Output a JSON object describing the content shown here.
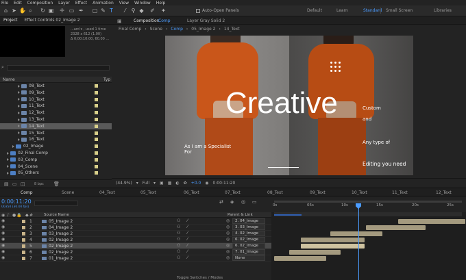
{
  "menu": [
    "File",
    "Edit",
    "Composition",
    "Layer",
    "Effect",
    "Animation",
    "View",
    "Window",
    "Help"
  ],
  "toolbar": {
    "auto_open_label": "Auto-Open Panels",
    "workspaces": [
      "Default",
      "Learn",
      "Standard",
      "Small Screen",
      "Libraries"
    ],
    "active_workspace": "Standard"
  },
  "project": {
    "tab_label": "Project",
    "effect_controls_label": "Effect Controls 02_Image 2",
    "info": [
      "...ard ▾ , used 1 time",
      "2328 x 612 (1.00)",
      "Δ 0;00:10:00, 60.00 ..."
    ],
    "header_name": "Name",
    "header_type": "Typ",
    "rows": [
      {
        "label": "08_Text",
        "color": "#d8cf8a",
        "indent": 3
      },
      {
        "label": "09_Text",
        "color": "#d8cf8a",
        "indent": 3
      },
      {
        "label": "10_Text",
        "color": "#d8cf8a",
        "indent": 3
      },
      {
        "label": "11_Text",
        "color": "#d8cf8a",
        "indent": 3
      },
      {
        "label": "12_Text",
        "color": "#d8cf8a",
        "indent": 3
      },
      {
        "label": "13_Text",
        "color": "#d8cf8a",
        "indent": 3
      },
      {
        "label": "14_Text",
        "color": "#d8cf8a",
        "indent": 3,
        "selected": true
      },
      {
        "label": "15_Text",
        "color": "#d8cf8a",
        "indent": 3
      },
      {
        "label": "16_Text",
        "color": "#d8cf8a",
        "indent": 3
      },
      {
        "label": "02_Image",
        "color": "#d8cf8a",
        "indent": 2
      },
      {
        "label": "02_Final Comp",
        "color": "#d8cf8a",
        "indent": 1
      },
      {
        "label": "03_Comp",
        "color": "#d8cf8a",
        "indent": 1
      },
      {
        "label": "04_Scene",
        "color": "#d8cf8a",
        "indent": 1
      },
      {
        "label": "05_Others",
        "color": "#d8cf8a",
        "indent": 1
      }
    ],
    "bpc": "8 bpc"
  },
  "composition": {
    "tab_label": "Composition",
    "tab_comp_name": "Comp",
    "layer_tab": "Layer  Gray Solid 2",
    "crumbs": [
      "Final Comp",
      "Scene",
      "Comp",
      "05_Image 2",
      "14_Text"
    ],
    "active_crumb": "Comp",
    "headline": "Creative",
    "left_caption": "As I am a Specialist",
    "left_caption2": "For",
    "right_lines": [
      "Custom",
      "and",
      "Any type of",
      "Editing you need"
    ],
    "zoom": "(44.9%)",
    "resolution": "Full",
    "exposure": "+0.0",
    "timecode_footer": "0:00:11:20"
  },
  "timeline": {
    "tabs": [
      "Comp",
      "Scene",
      "04_Text",
      "05_Text",
      "06_Text",
      "07_Text",
      "08_Text",
      "09_Text",
      "10_Text",
      "11_Text",
      "12_Text"
    ],
    "active_tab": "Comp",
    "timecode": "0:00:11:20",
    "fps": "00350 (30.00 fps)",
    "col_source": "Source Name",
    "col_parent": "Parent & Link",
    "ruler": [
      "0s",
      "05s",
      "10s",
      "15s",
      "20s",
      "25s"
    ],
    "layers": [
      {
        "num": "1",
        "name": "05_Image 2",
        "parent": "2. 04_Image",
        "selected": false
      },
      {
        "num": "2",
        "name": "04_Image 2",
        "parent": "3. 03_Image",
        "selected": false
      },
      {
        "num": "3",
        "name": "03_Image 2",
        "parent": "4. 02_Image",
        "selected": false
      },
      {
        "num": "4",
        "name": "02_Image 2",
        "parent": "6. 02_Image",
        "selected": false
      },
      {
        "num": "5",
        "name": "02_Image 2",
        "parent": "6. 02_Image",
        "selected": true
      },
      {
        "num": "6",
        "name": "02_Image 2",
        "parent": "7. 01_Image",
        "selected": false
      },
      {
        "num": "7",
        "name": "01_Image 2",
        "parent": "None",
        "selected": false
      }
    ],
    "footer": "Toggle Switches / Modes"
  },
  "colors": {
    "accent": "#4b9cff",
    "sweater": "#d8621a",
    "label_tan": "#c9b48a"
  }
}
